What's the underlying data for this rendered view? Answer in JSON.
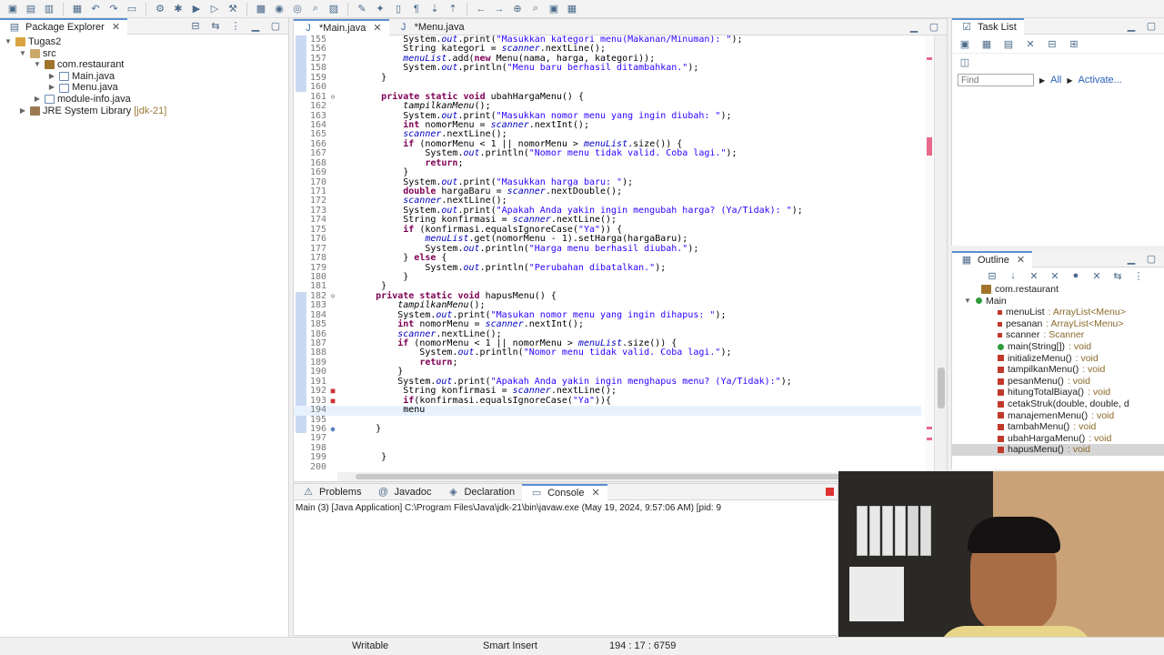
{
  "toolbar": {
    "icons": [
      "new-icon",
      "save-icon",
      "save-all-icon",
      "print-icon",
      "undo-icon",
      "redo-icon",
      "terminal-icon",
      "tool-icon",
      "debug-icon",
      "run-icon",
      "coverage-icon",
      "external-tools-icon",
      "new-package-icon",
      "new-class-icon",
      "open-type-icon",
      "search-icon",
      "open-task-icon",
      "annotation-icon",
      "mark-occurrences-icon",
      "block-selection-icon",
      "show-whitespace-icon",
      "next-annotation-icon",
      "prev-annotation-icon",
      "back-icon",
      "forward-icon",
      "pin-icon",
      "quick-access-icon",
      "perspective-icon",
      "java-perspective-icon"
    ]
  },
  "package_explorer": {
    "title": "Package Explorer",
    "tree": [
      {
        "label": "Tugas2",
        "level": 0,
        "icon": "project-icon",
        "expanded": true
      },
      {
        "label": "src",
        "level": 1,
        "icon": "src-folder-icon",
        "expanded": true
      },
      {
        "label": "com.restaurant",
        "level": 2,
        "icon": "package-icon",
        "expanded": true
      },
      {
        "label": "Main.java",
        "level": 3,
        "icon": "java-file-icon",
        "expanded": false
      },
      {
        "label": "Menu.java",
        "level": 3,
        "icon": "java-file-icon",
        "expanded": false
      },
      {
        "label": "module-info.java",
        "level": 2,
        "icon": "java-file-icon",
        "expanded": false
      },
      {
        "label": "JRE System Library",
        "version": "[jdk-21]",
        "level": 1,
        "icon": "library-icon",
        "expanded": false
      }
    ]
  },
  "editor": {
    "tabs": [
      {
        "label": "*Main.java",
        "active": true
      },
      {
        "label": "*Menu.java",
        "active": false
      }
    ],
    "lines": [
      {
        "n": "155",
        "text": "            System.out.print(\"Masukkan kategori menu(Makanan/Minuman): \");"
      },
      {
        "n": "156",
        "text": "            String kategori = scanner.nextLine();"
      },
      {
        "n": "157",
        "text": "            menuList.add(new Menu(nama, harga, kategori));"
      },
      {
        "n": "158",
        "text": "            System.out.println(\"Menu baru berhasil ditambahkan.\");"
      },
      {
        "n": "159",
        "text": "        }"
      },
      {
        "n": "160",
        "text": ""
      },
      {
        "n": "161",
        "text": "        private static void ubahHargaMenu() {"
      },
      {
        "n": "162",
        "text": "            tampilkanMenu();"
      },
      {
        "n": "163",
        "text": "            System.out.print(\"Masukkan nomor menu yang ingin diubah: \");"
      },
      {
        "n": "164",
        "text": "            int nomorMenu = scanner.nextInt();"
      },
      {
        "n": "165",
        "text": "            scanner.nextLine();"
      },
      {
        "n": "166",
        "text": "            if (nomorMenu < 1 || nomorMenu > menuList.size()) {"
      },
      {
        "n": "167",
        "text": "                System.out.println(\"Nomor menu tidak valid. Coba lagi.\");"
      },
      {
        "n": "168",
        "text": "                return;"
      },
      {
        "n": "169",
        "text": "            }"
      },
      {
        "n": "170",
        "text": "            System.out.print(\"Masukkan harga baru: \");"
      },
      {
        "n": "171",
        "text": "            double hargaBaru = scanner.nextDouble();"
      },
      {
        "n": "172",
        "text": "            scanner.nextLine();"
      },
      {
        "n": "173",
        "text": "            System.out.print(\"Apakah Anda yakin ingin mengubah harga? (Ya/Tidak): \");"
      },
      {
        "n": "174",
        "text": "            String konfirmasi = scanner.nextLine();"
      },
      {
        "n": "175",
        "text": "            if (konfirmasi.equalsIgnoreCase(\"Ya\")) {"
      },
      {
        "n": "176",
        "text": "                menuList.get(nomorMenu - 1).setHarga(hargaBaru);"
      },
      {
        "n": "177",
        "text": "                System.out.println(\"Harga menu berhasil diubah.\");"
      },
      {
        "n": "178",
        "text": "            } else {"
      },
      {
        "n": "179",
        "text": "                System.out.println(\"Perubahan dibatalkan.\");"
      },
      {
        "n": "180",
        "text": "            }"
      },
      {
        "n": "181",
        "text": "        }"
      },
      {
        "n": "182",
        "text": "       private static void hapusMenu() {"
      },
      {
        "n": "183",
        "text": "           tampilkanMenu();"
      },
      {
        "n": "184",
        "text": "           System.out.print(\"Masukan nomor menu yang ingin dihapus: \");"
      },
      {
        "n": "185",
        "text": "           int nomorMenu = scanner.nextInt();"
      },
      {
        "n": "186",
        "text": "           scanner.nextLine();"
      },
      {
        "n": "187",
        "text": "           if (nomorMenu < 1 || nomorMenu > menuList.size()) {"
      },
      {
        "n": "188",
        "text": "               System.out.println(\"Nomor menu tidak valid. Coba lagi.\");"
      },
      {
        "n": "189",
        "text": "               return;"
      },
      {
        "n": "190",
        "text": "           }"
      },
      {
        "n": "191",
        "text": "           System.out.print(\"Apakah Anda yakin ingin menghapus menu? (Ya/Tidak):\");"
      },
      {
        "n": "192",
        "text": "            String konfirmasi = scanner.nextLine();"
      },
      {
        "n": "193",
        "text": "            if(konfirmasi.equalsIgnoreCase(\"Ya\")){"
      },
      {
        "n": "194",
        "text": "            menu"
      },
      {
        "n": "195",
        "text": ""
      },
      {
        "n": "196",
        "text": "       }"
      },
      {
        "n": "197",
        "text": ""
      },
      {
        "n": "198",
        "text": ""
      },
      {
        "n": "199",
        "text": "        }"
      },
      {
        "n": "200",
        "text": ""
      }
    ],
    "error_lines": [
      "192",
      "193"
    ],
    "current_line": "194"
  },
  "task_list": {
    "title": "Task List",
    "find_placeholder": "Find",
    "all_label": "All",
    "activate_label": "Activate..."
  },
  "outline": {
    "title": "Outline",
    "package": "com.restaurant",
    "class": "Main",
    "members": [
      {
        "name": "menuList",
        "type": " : ArrayList<Menu>",
        "kind": "field",
        "selected": false
      },
      {
        "name": "pesanan",
        "type": " : ArrayList<Menu>",
        "kind": "field",
        "selected": false
      },
      {
        "name": "scanner",
        "type": " : Scanner",
        "kind": "field",
        "selected": false
      },
      {
        "name": "main(String[])",
        "type": " : void",
        "kind": "public",
        "selected": false
      },
      {
        "name": "initializeMenu()",
        "type": " : void",
        "kind": "private",
        "selected": false
      },
      {
        "name": "tampilkanMenu()",
        "type": " : void",
        "kind": "private",
        "selected": false
      },
      {
        "name": "pesanMenu()",
        "type": " : void",
        "kind": "private",
        "selected": false
      },
      {
        "name": "hitungTotalBiaya()",
        "type": " : void",
        "kind": "private",
        "selected": false
      },
      {
        "name": "cetakStruk(double, double, d",
        "type": "",
        "kind": "private",
        "selected": false
      },
      {
        "name": "manajemenMenu()",
        "type": " : void",
        "kind": "private",
        "selected": false
      },
      {
        "name": "tambahMenu()",
        "type": " : void",
        "kind": "private",
        "selected": false
      },
      {
        "name": "ubahHargaMenu()",
        "type": " : void",
        "kind": "private",
        "selected": false
      },
      {
        "name": "hapusMenu()",
        "type": " : void",
        "kind": "private",
        "selected": true
      }
    ]
  },
  "bottom_panel": {
    "tabs": [
      {
        "label": "Problems",
        "active": false
      },
      {
        "label": "Javadoc",
        "active": false
      },
      {
        "label": "Declaration",
        "active": false
      },
      {
        "label": "Console",
        "active": true
      }
    ],
    "console_line": "Main (3) [Java Application] C:\\Program Files\\Java\\jdk-21\\bin\\javaw.exe  (May 19, 2024, 9:57:06 AM) [pid: 9"
  },
  "status_bar": {
    "writable": "Writable",
    "insert_mode": "Smart Insert",
    "position": "194 : 17 : 6759"
  },
  "colors": {
    "keyword": "#7f0055",
    "string": "#2a00ff",
    "field": "#0000c0",
    "active_tab_accent": "#5a8fd0"
  }
}
